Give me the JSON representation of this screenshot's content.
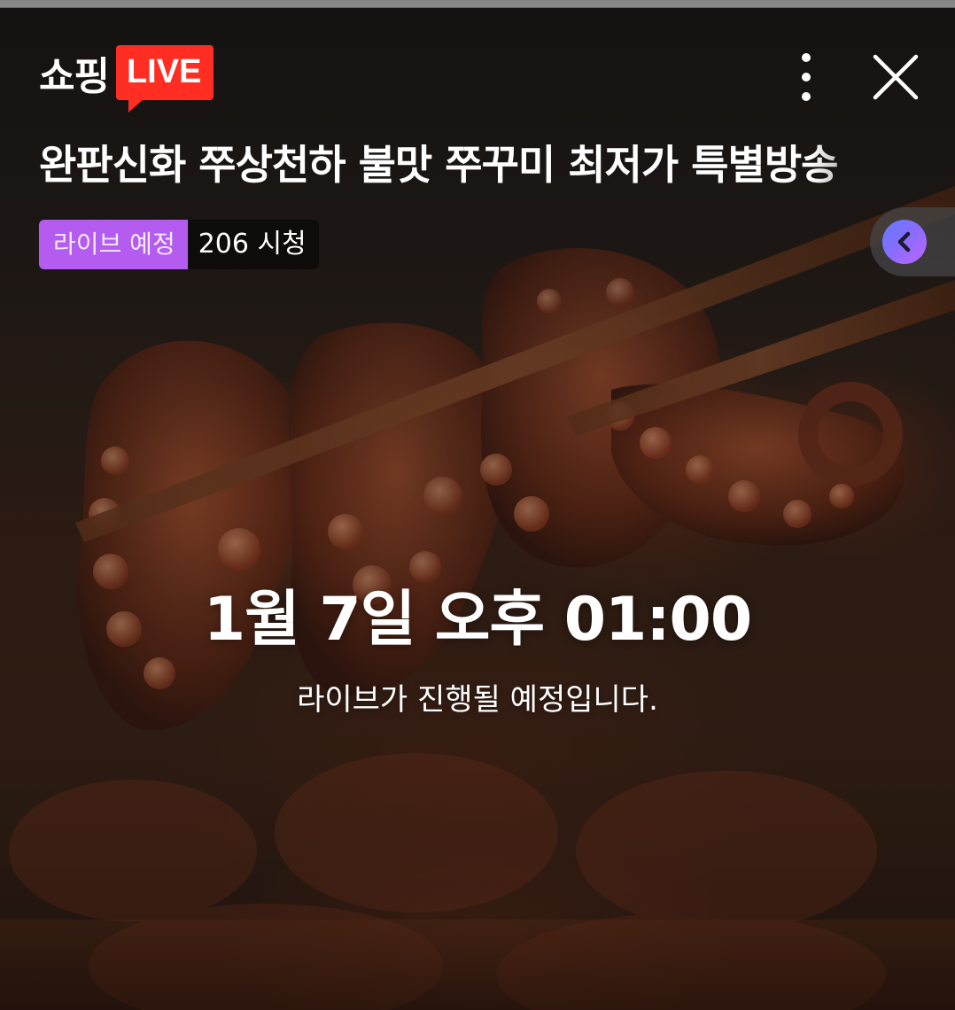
{
  "header": {
    "brand": "쇼핑",
    "live_badge": "LIVE",
    "more_icon": "more-vertical-icon",
    "close_icon": "close-icon"
  },
  "broadcast": {
    "title": "완판신화 쭈상천하 불맛 쭈꾸미 최저가 특별방송",
    "status_badge": "라이브 예정",
    "viewers": "206 시청"
  },
  "side_tab": {
    "icon": "chevron-left-icon"
  },
  "schedule": {
    "time": "1월 7일 오후 01:00",
    "message": "라이브가 진행될 예정입니다."
  },
  "colors": {
    "live_red": "#ff2d22",
    "status_purple": "#b45cf0",
    "side_gradient_start": "#5f7bff",
    "side_gradient_end": "#c066ff"
  }
}
